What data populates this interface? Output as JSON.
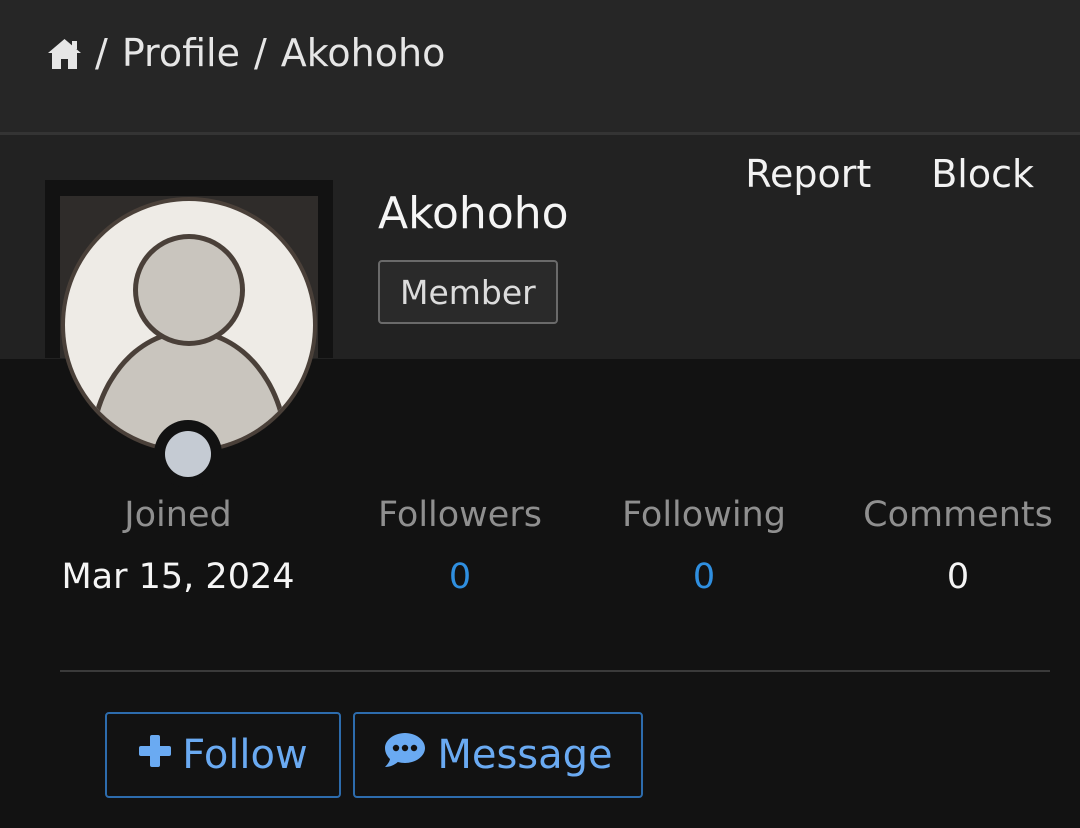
{
  "breadcrumb": {
    "home_icon": "home-icon",
    "separator": "/",
    "items": [
      {
        "label": "Profile"
      },
      {
        "label": "Akohoho"
      }
    ]
  },
  "actions": {
    "report_label": "Report",
    "block_label": "Block"
  },
  "profile": {
    "username": "Akohoho",
    "role": "Member",
    "avatar_icon": "default-user-avatar",
    "online_status_color": "#c5cbd3"
  },
  "stats": {
    "joined": {
      "label": "Joined",
      "value": "Mar 15, 2024"
    },
    "followers": {
      "label": "Followers",
      "value": "0"
    },
    "following": {
      "label": "Following",
      "value": "0"
    },
    "comments": {
      "label": "Comments",
      "value": "0"
    }
  },
  "buttons": {
    "follow": {
      "label": "Follow",
      "icon": "plus-icon"
    },
    "message": {
      "label": "Message",
      "icon": "chat-bubble-icon"
    }
  },
  "colors": {
    "accent": "#6aaaf2",
    "link": "#2f8fe0",
    "button_border": "#2d6cad"
  }
}
